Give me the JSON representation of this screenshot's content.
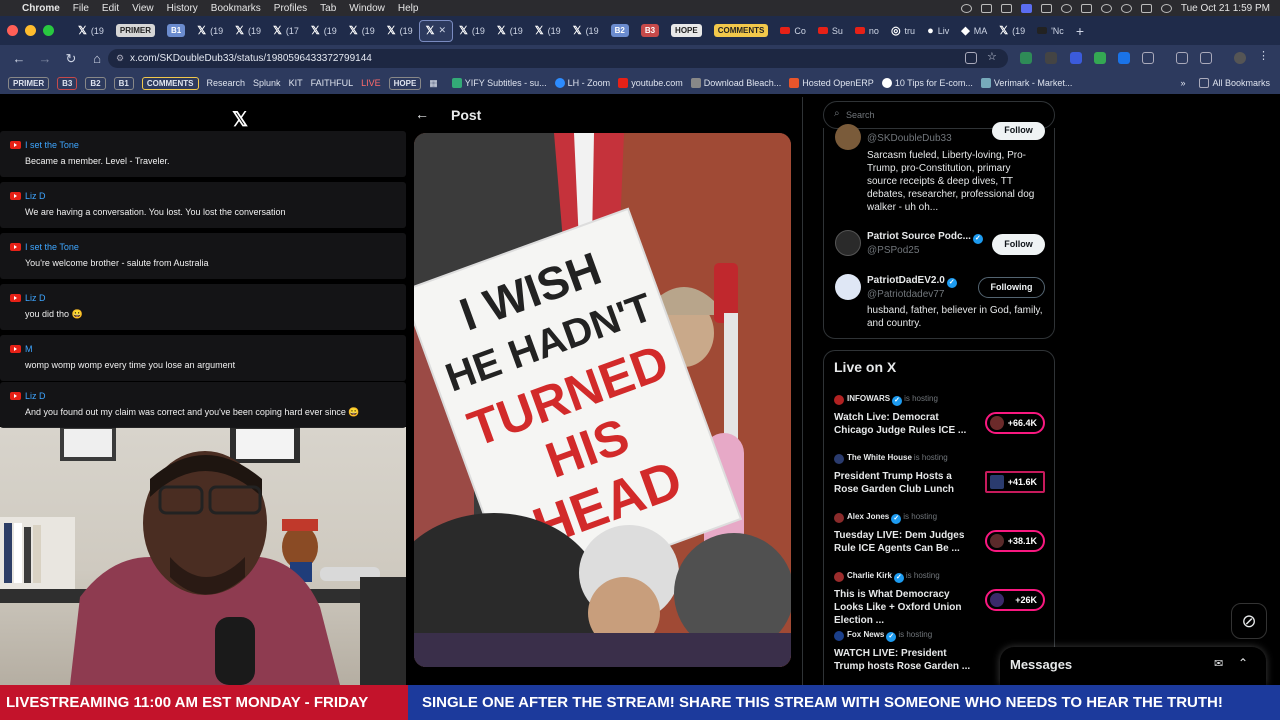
{
  "menubar": {
    "app": "Chrome",
    "items": [
      "File",
      "Edit",
      "View",
      "History",
      "Bookmarks",
      "Profiles",
      "Tab",
      "Window",
      "Help"
    ],
    "clock": "Tue Oct 21  1:59 PM"
  },
  "tabs": {
    "primer": "PRIMER",
    "b1": "B1",
    "b2": "B2",
    "b3": "B3",
    "hope": "HOPE",
    "comments": "COMMENTS",
    "x_tab": "(19",
    "x_tab_17": "(17",
    "co": "Co",
    "su": "Su",
    "no": "no",
    "tru": "tru",
    "liv": "Liv",
    "ma": "MA",
    "nc": "'Nc"
  },
  "address": {
    "url": "x.com/SKDoubleDub33/status/1980596433372799144"
  },
  "bookmarks": {
    "primer": "PRIMER",
    "b3": "B3",
    "b2": "B2",
    "b1": "B1",
    "comments": "COMMENTS",
    "research": "Research",
    "splunk": "Splunk",
    "kit": "KIT",
    "faithful": "FAITHFUL",
    "live": "LIVE",
    "hope": "HOPE",
    "yify": "YIFY Subtitles - su...",
    "zoom": "LH - Zoom",
    "youtube": "youtube.com",
    "bleach": "Download Bleach...",
    "openerp": "Hosted OpenERP",
    "tips": "10 Tips for E-com...",
    "verimark": "Verimark - Market...",
    "all": "All Bookmarks"
  },
  "chat": [
    {
      "author": "I set the Tone",
      "text": "Became a member. Level - Traveler."
    },
    {
      "author": "Liz D",
      "text": "We are having a conversation. You lost. You lost the conversation"
    },
    {
      "author": "I set the Tone",
      "text": "You're welcome brother - salute from Australia"
    },
    {
      "author": "Liz D",
      "text": "you did tho 😀"
    },
    {
      "author": "M",
      "text": "womp womp womp every time you lose an argument"
    },
    {
      "author": "Liz D",
      "text": "And you found out my claim was correct and you've been coping hard ever since 😀"
    }
  ],
  "post": {
    "title": "Post",
    "sign": {
      "line1": "I WISH",
      "line2": "HE HADN'T",
      "line3": "TURNED",
      "line4": "HIS",
      "line5": "HEAD"
    }
  },
  "search": {
    "placeholder": "Search"
  },
  "who_to_follow": [
    {
      "name": "",
      "handle": "@SKDoubleDub33",
      "bio": "Sarcasm fueled, Liberty-loving, Pro-Trump, pro-Constitution, primary source receipts & deep dives, TT debates, researcher, professional dog walker - uh oh...",
      "button": "Follow"
    },
    {
      "name": "Patriot Source Podc...",
      "handle": "@PSPod25",
      "bio": "",
      "button": "Follow"
    },
    {
      "name": "PatriotDadEV2.0",
      "handle": "@Patriotdadev77",
      "bio": "husband, father, believer in God, family, and country.",
      "button": "Following"
    }
  ],
  "live_on_x": {
    "title": "Live on X",
    "hosting_label": "is hosting",
    "items": [
      {
        "host": "INFOWARS",
        "title": "Watch Live: Democrat Chicago Judge Rules ICE ...",
        "count": "+66.4K",
        "color": "#b22222"
      },
      {
        "host": "The White House",
        "title": "President Trump Hosts a Rose Garden Club Lunch",
        "count": "+41.6K",
        "color": "#2a3b6e"
      },
      {
        "host": "Alex Jones",
        "title": "Tuesday LIVE: Dem Judges Rule ICE Agents Can Be ...",
        "count": "+38.1K",
        "color": "#8a2b2b"
      },
      {
        "host": "Charlie Kirk",
        "title": "This is What Democracy Looks Like + Oxford Union Election ...",
        "count": "+26K",
        "color": "#9b2c2c"
      },
      {
        "host": "Fox News",
        "title": "WATCH LIVE: President Trump hosts Rose Garden ...",
        "count": "",
        "color": "#1b3f8a"
      }
    ]
  },
  "messages": {
    "label": "Messages"
  },
  "ticker": {
    "left": "LIVESTREAMING 11:00 AM EST MONDAY - FRIDAY",
    "right": "SINGLE ONE AFTER THE STREAM! SHARE THIS STREAM WITH SOMEONE WHO NEEDS TO HEAR THE TRUTH!"
  },
  "colors": {
    "accent": "#1d9bf0",
    "live_ring": "#f91880",
    "ticker_red": "#c3132b",
    "ticker_blue": "#1c3a9c"
  }
}
